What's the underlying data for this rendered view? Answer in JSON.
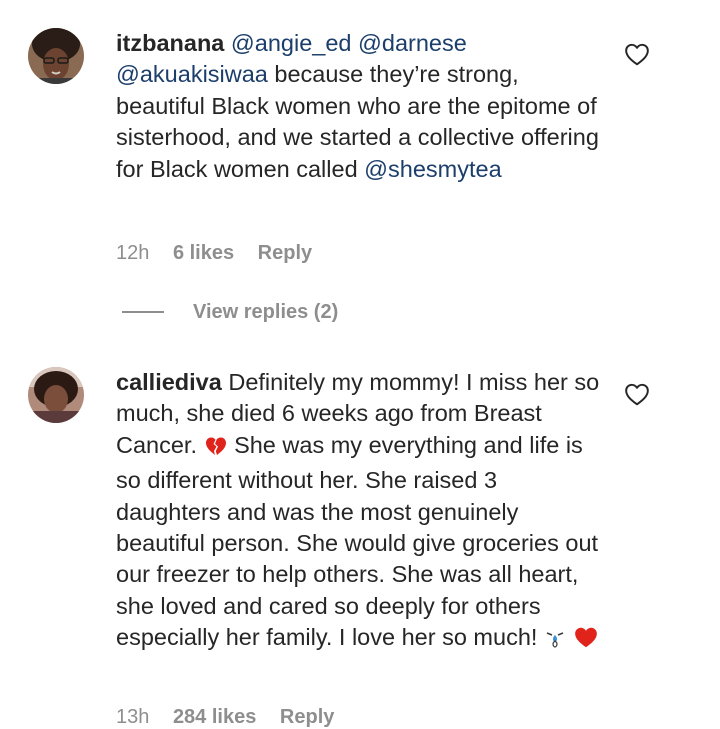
{
  "comments": [
    {
      "username": "itzbanana",
      "mentions": [
        "@angie_ed",
        "@darnese",
        "@akuakisiwaa"
      ],
      "text": "because they’re strong, beautiful Black women who are the epitome of sisterhood, and we started a collective offering for Black women called",
      "trailing_mention": "@shesmytea",
      "time": "12h",
      "likes": "6 likes",
      "reply_label": "Reply",
      "view_replies": "View replies (2)"
    },
    {
      "username": "calliediva",
      "text_part1": "Definitely my mommy! I miss her so much, she died 6 weeks ago from Breast Cancer.",
      "text_part2": "She was my everything and life is so different without her. She raised 3 daughters and was the most genuinely beautiful person. She would give groceries out our freezer to help others. She was all heart, she loved and cared so deeply for others especially her family. I love her so much!",
      "time": "13h",
      "likes": "284 likes",
      "reply_label": "Reply"
    }
  ],
  "icons": {
    "like": "heart-outline-icon",
    "broken_heart": "broken-heart-icon",
    "tear": "crying-tear-icon",
    "red_heart": "red-heart-icon"
  },
  "colors": {
    "text": "#262626",
    "mention": "#1b3e6b",
    "meta": "#8e8e8e",
    "heart": "#e0241b"
  }
}
